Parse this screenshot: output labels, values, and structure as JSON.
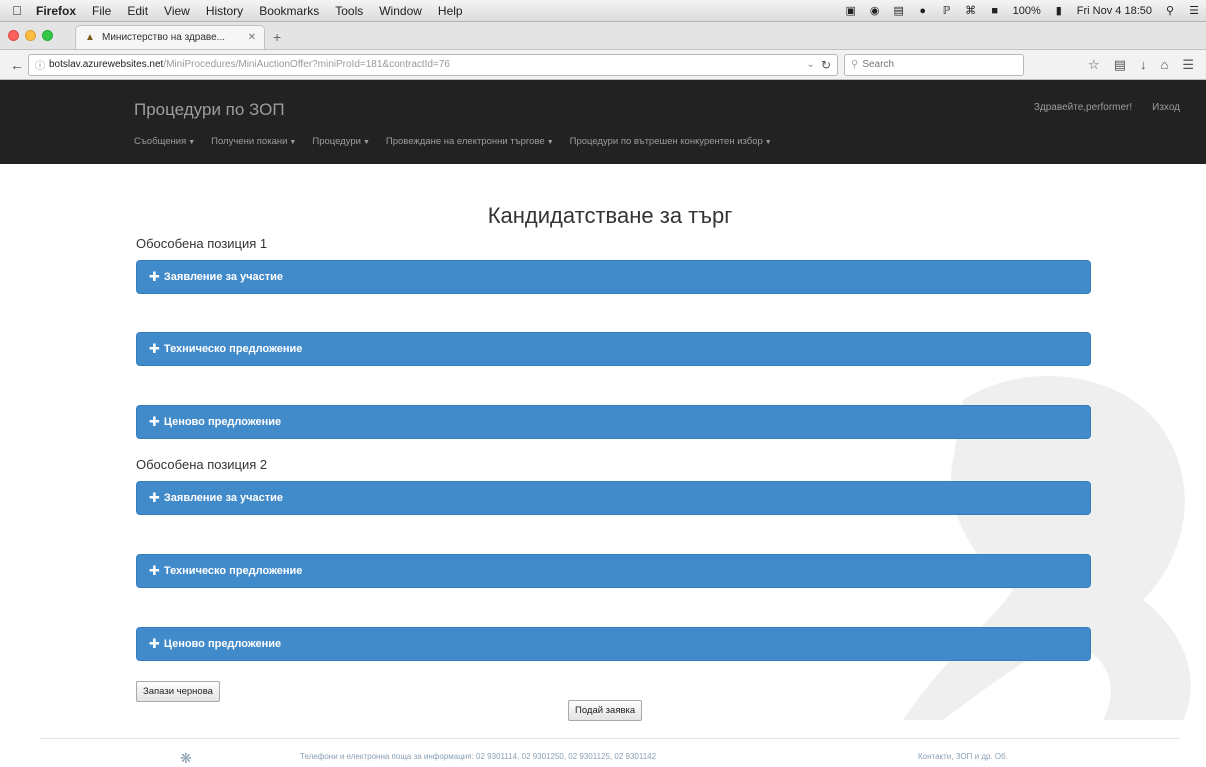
{
  "menubar": {
    "app": "Firefox",
    "items": [
      "File",
      "Edit",
      "View",
      "History",
      "Bookmarks",
      "Tools",
      "Window",
      "Help"
    ],
    "battery": "100%",
    "clock": "Fri Nov 4 18:50"
  },
  "browser": {
    "tab_title": "Министерство на здраве...",
    "url_host": "botslav.azurewebsites.net",
    "url_path": "/MiniProcedures/MiniAuctionOffer?miniProId=181&contractId=76",
    "search_placeholder": "Search"
  },
  "site": {
    "brand": "Процедури по ЗОП",
    "nav_links": [
      "Съобщения",
      "Получени покани",
      "Процедури",
      "Провеждане на електронни търгове",
      "Процедури по вътрешен конкурентен избор"
    ],
    "greeting": "Здравейте,performer!",
    "logout": "Изход"
  },
  "main": {
    "title": "Кандидатстване за търг",
    "positions": [
      {
        "heading": "Обособена позиция 1",
        "panels": [
          "Заявление за участие",
          "Техническо предложение",
          "Ценово предложение"
        ]
      },
      {
        "heading": "Обособена позиция 2",
        "panels": [
          "Заявление за участие",
          "Техническо предложение",
          "Ценово предложение"
        ]
      }
    ],
    "save_draft": "Запази чернова",
    "submit": "Подай заявка"
  },
  "footer": {
    "contact": "Телефони и електронна поща за информация: 02 9301114, 02 9301250, 02 9301125, 02 9301142",
    "right": "Контакти, ЗОП и др. Об."
  },
  "colors": {
    "panel": "#428bca",
    "navbar": "#222222"
  }
}
